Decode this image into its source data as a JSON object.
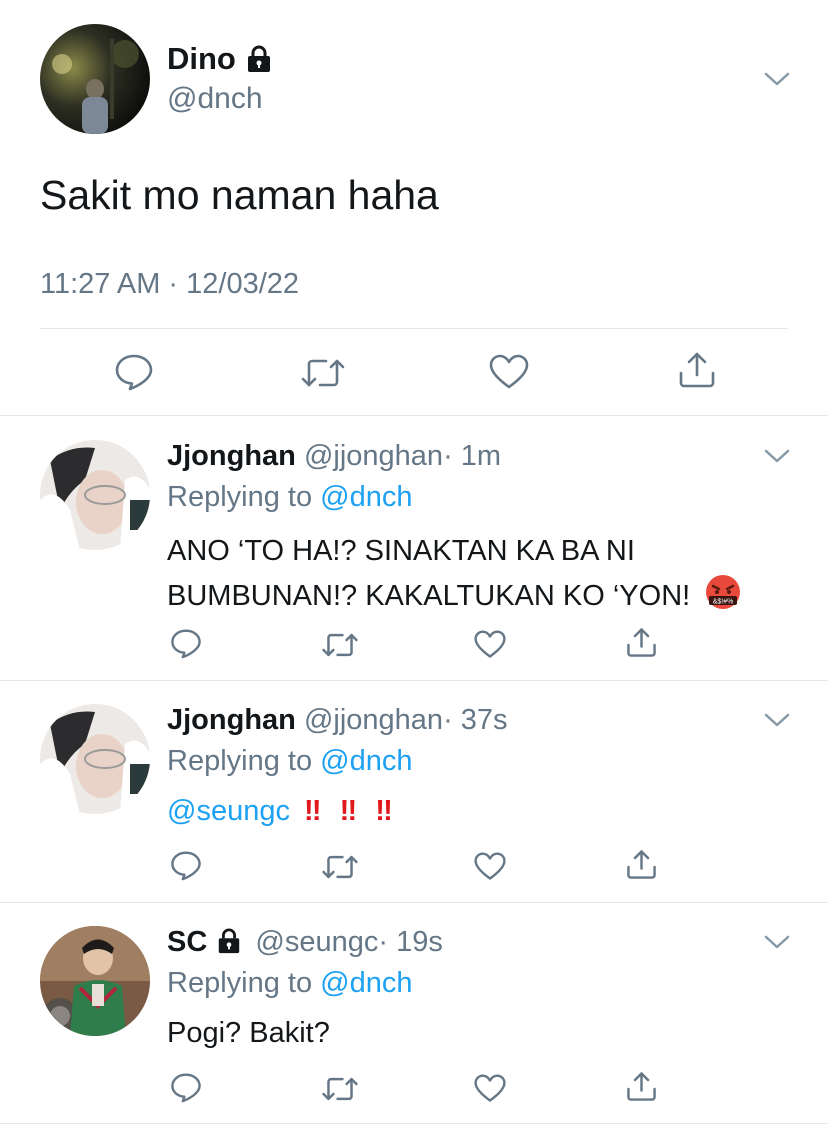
{
  "main_tweet": {
    "name": "Dino",
    "handle": "@dnch",
    "text": "Sakit mo naman haha",
    "timestamp": "11:27 AM · 12/03/22",
    "protected": true
  },
  "replies": [
    {
      "name": "Jjonghan",
      "handle": "@jjonghan",
      "time": "· 1m",
      "replying_prefix": "Replying to",
      "replying_handle": "@dnch",
      "line1": "ANO ‘TO HA!? SINAKTAN KA BA NI",
      "line2": "BUMBUNAN!? KAKALTUKAN KO ‘YON!",
      "emoji": "face-with-symbols-on-mouth",
      "emoji_text": "&$!#%"
    },
    {
      "name": "Jjonghan",
      "handle": "@jjonghan",
      "time": "· 37s",
      "replying_prefix": "Replying to",
      "replying_handle": "@dnch",
      "mention": "@seungc",
      "exclamations": [
        "‼",
        "‼",
        "‼"
      ]
    },
    {
      "name": "SC",
      "handle": "@seungc",
      "time": "· 19s",
      "replying_prefix": "Replying to",
      "replying_handle": "@dnch",
      "text": "Pogi? Bakit?",
      "protected": true
    }
  ],
  "actions": [
    "reply-icon",
    "retweet-icon",
    "like-icon",
    "share-icon"
  ],
  "colors": {
    "text": "#14171a",
    "muted": "#657786",
    "link": "#1da1f2",
    "divider": "#e1e8ed",
    "exclaim": "#e0191f"
  }
}
